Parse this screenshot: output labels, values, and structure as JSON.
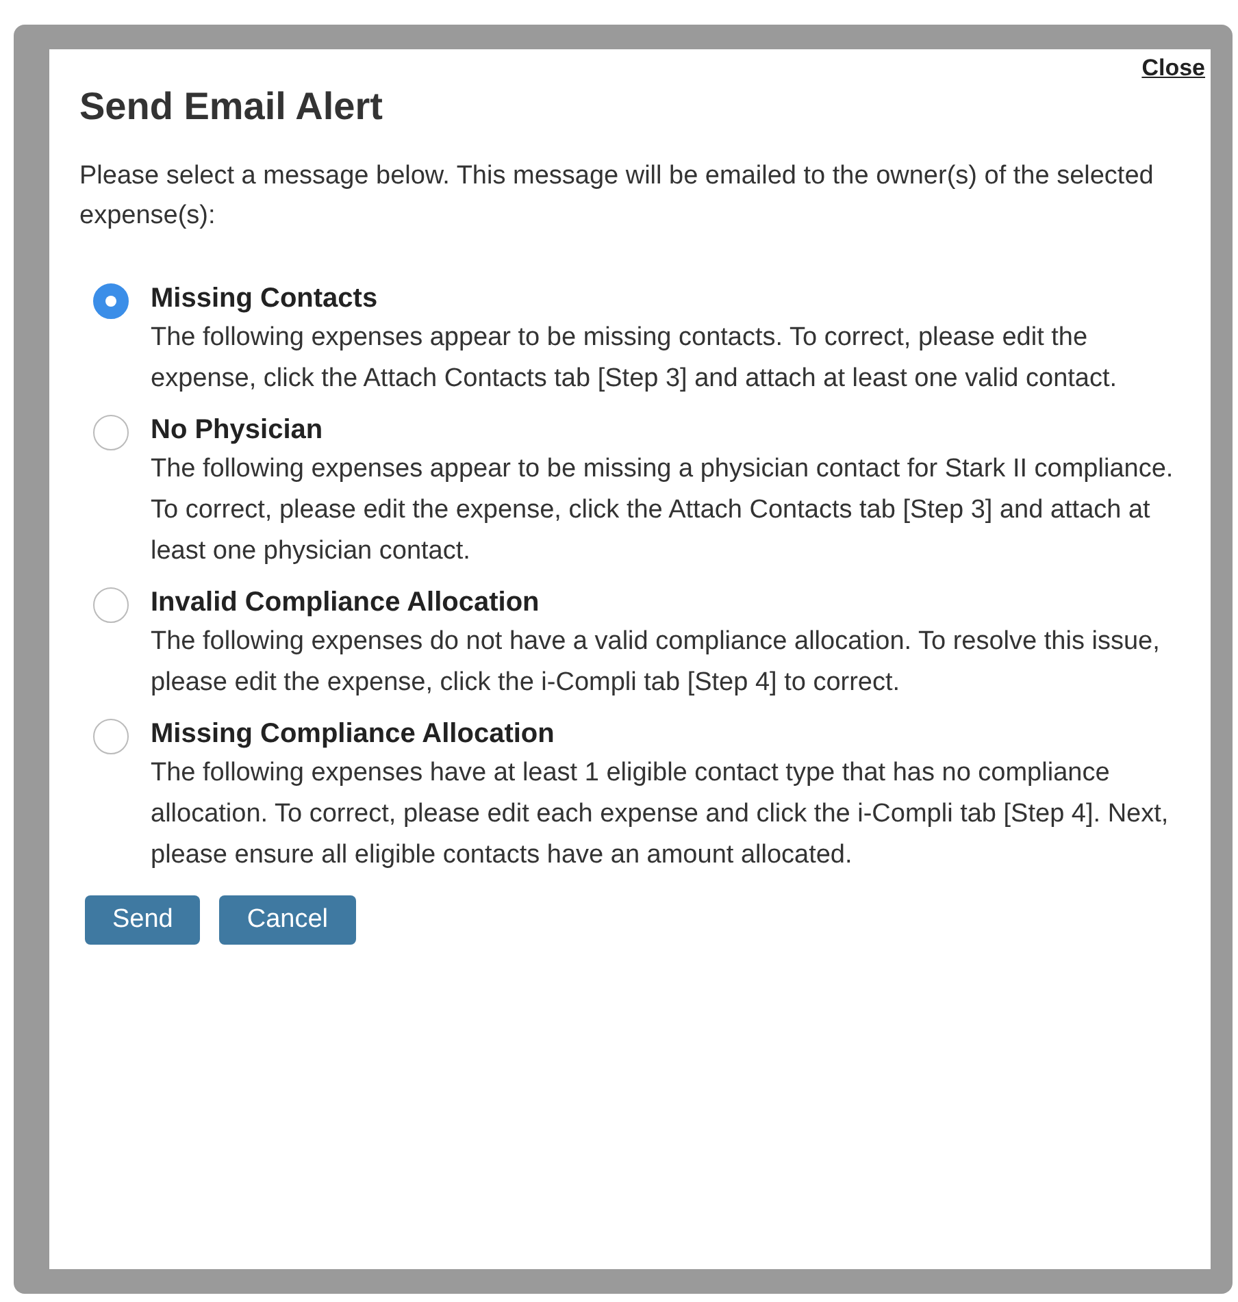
{
  "dialog": {
    "title": "Send Email Alert",
    "close_link": "Close",
    "intro": "Please select a message below. This message will be emailed to the owner(s) of the selected expense(s):",
    "options": [
      {
        "title": "Missing Contacts",
        "description": "The following expenses appear to be missing contacts. To correct, please edit the expense, click the Attach Contacts tab [Step 3] and attach at least one valid contact.",
        "selected": true
      },
      {
        "title": "No Physician",
        "description": "The following expenses appear to be missing a physician contact for Stark II compliance. To correct, please edit the expense, click the Attach Contacts tab [Step 3] and attach at least one physician contact.",
        "selected": false
      },
      {
        "title": "Invalid Compliance Allocation",
        "description": "The following expenses do not have a valid compliance allocation. To resolve this issue, please edit the expense, click the i-Compli tab [Step 4] to correct.",
        "selected": false
      },
      {
        "title": "Missing Compliance Allocation",
        "description": "The following expenses have at least 1 eligible contact type that has no compliance allocation. To correct, please edit each expense and click the i-Compli tab [Step 4]. Next, please ensure all eligible contacts have an amount allocated.",
        "selected": false
      }
    ],
    "buttons": [
      "Send",
      "Cancel"
    ]
  }
}
